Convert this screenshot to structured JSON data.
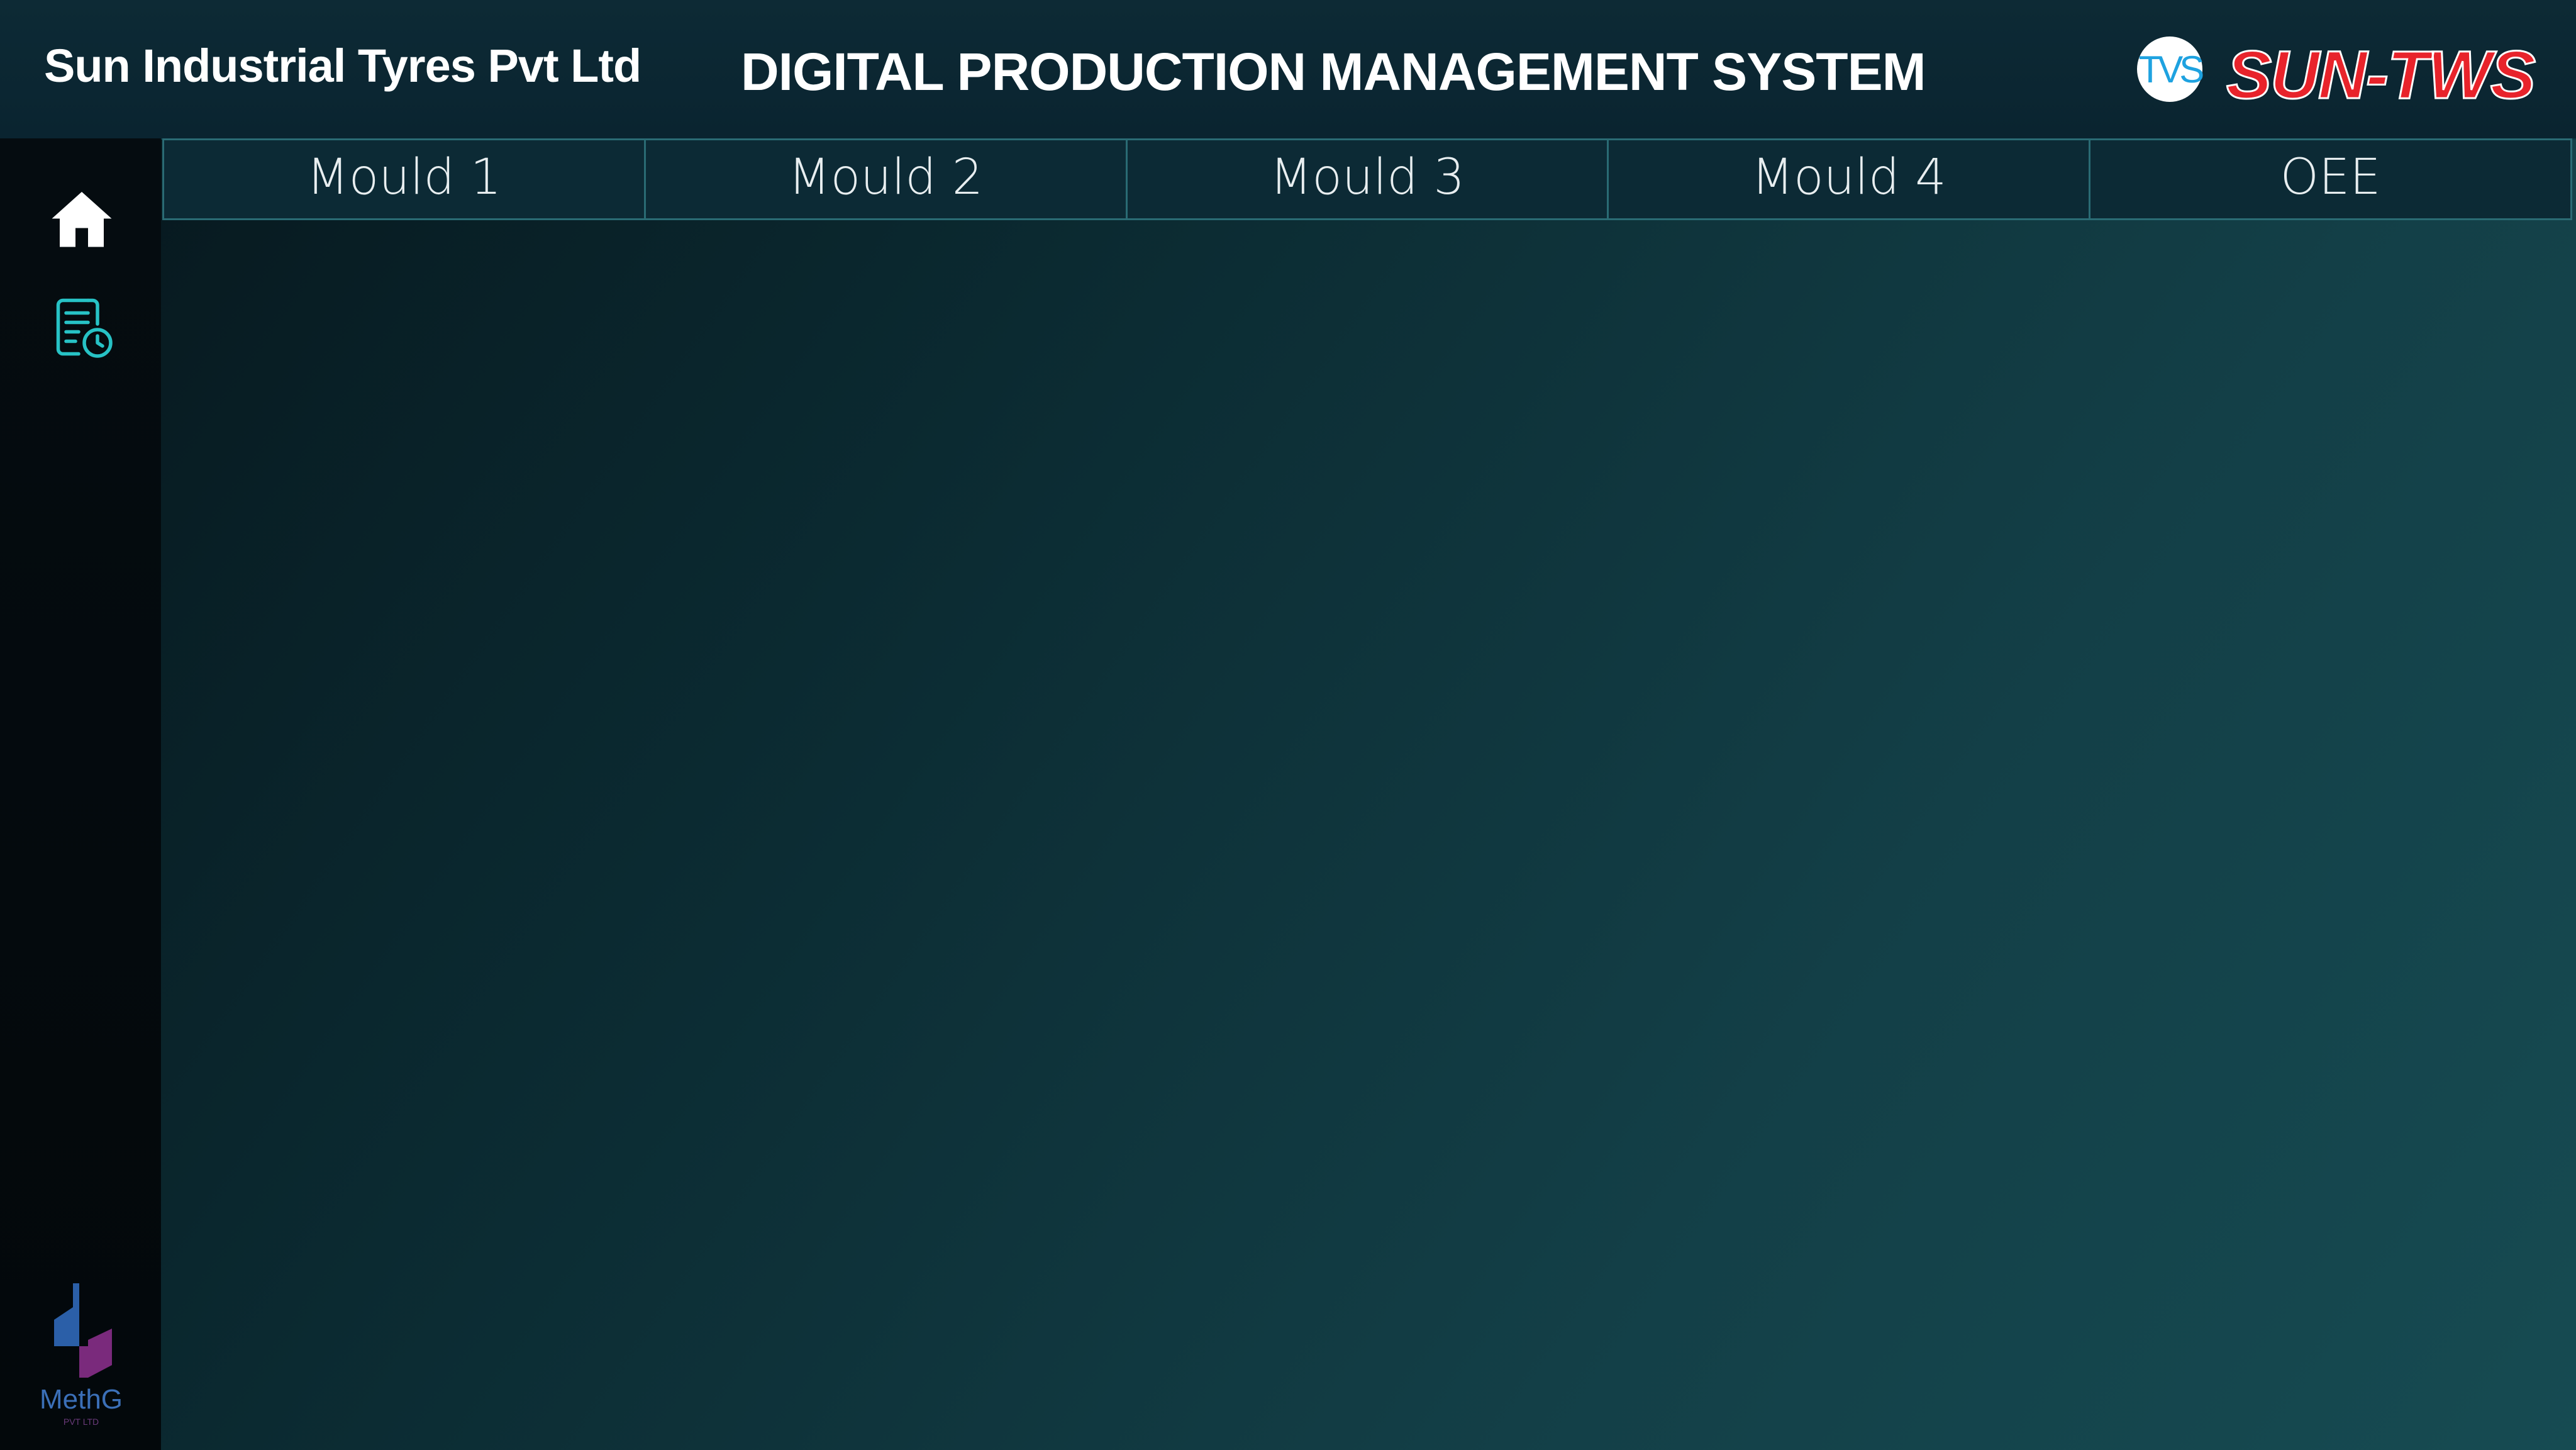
{
  "header": {
    "company_name": "Sun Industrial Tyres Pvt Ltd",
    "system_title": "DIGITAL PRODUCTION MANAGEMENT SYSTEM",
    "badge_text": "TVS",
    "brand_text": "SUN-TWS"
  },
  "sidebar": {
    "items": [
      {
        "icon": "home-icon"
      },
      {
        "icon": "report-clock-icon"
      }
    ],
    "footer_logo": {
      "label": "MethG",
      "sub_label": "PVT LTD"
    }
  },
  "tabs": [
    {
      "label": "Mould  1"
    },
    {
      "label": "Mould 2"
    },
    {
      "label": "Mould 3"
    },
    {
      "label": "Mould 4"
    },
    {
      "label": "OEE"
    }
  ],
  "colors": {
    "accent_teal": "#2a6b74",
    "brand_red": "#e8232b",
    "badge_blue": "#1ea2e0",
    "icon_teal": "#27c2c5"
  }
}
